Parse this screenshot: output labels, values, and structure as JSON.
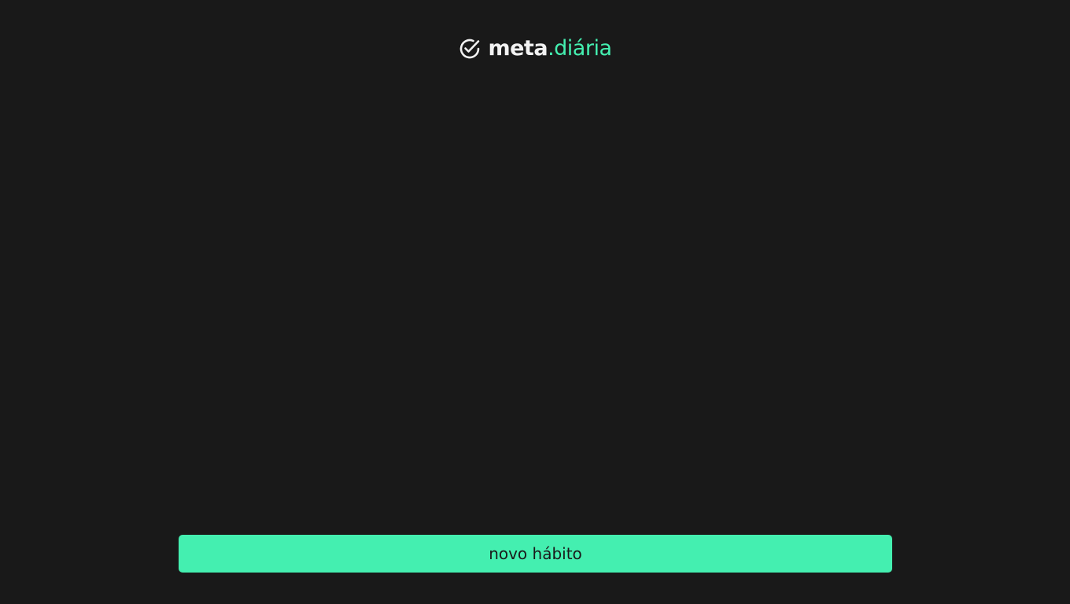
{
  "app": {
    "logo": {
      "icon": "check-circle-icon",
      "text_main": "meta",
      "text_dot": ".",
      "text_accent": "diária"
    }
  },
  "actions": {
    "new_habit_label": "novo hábito"
  },
  "colors": {
    "background": "#191919",
    "accent": "#44efb0",
    "logo_text": "#f2f2f2",
    "button_text": "#1a1a1a"
  }
}
